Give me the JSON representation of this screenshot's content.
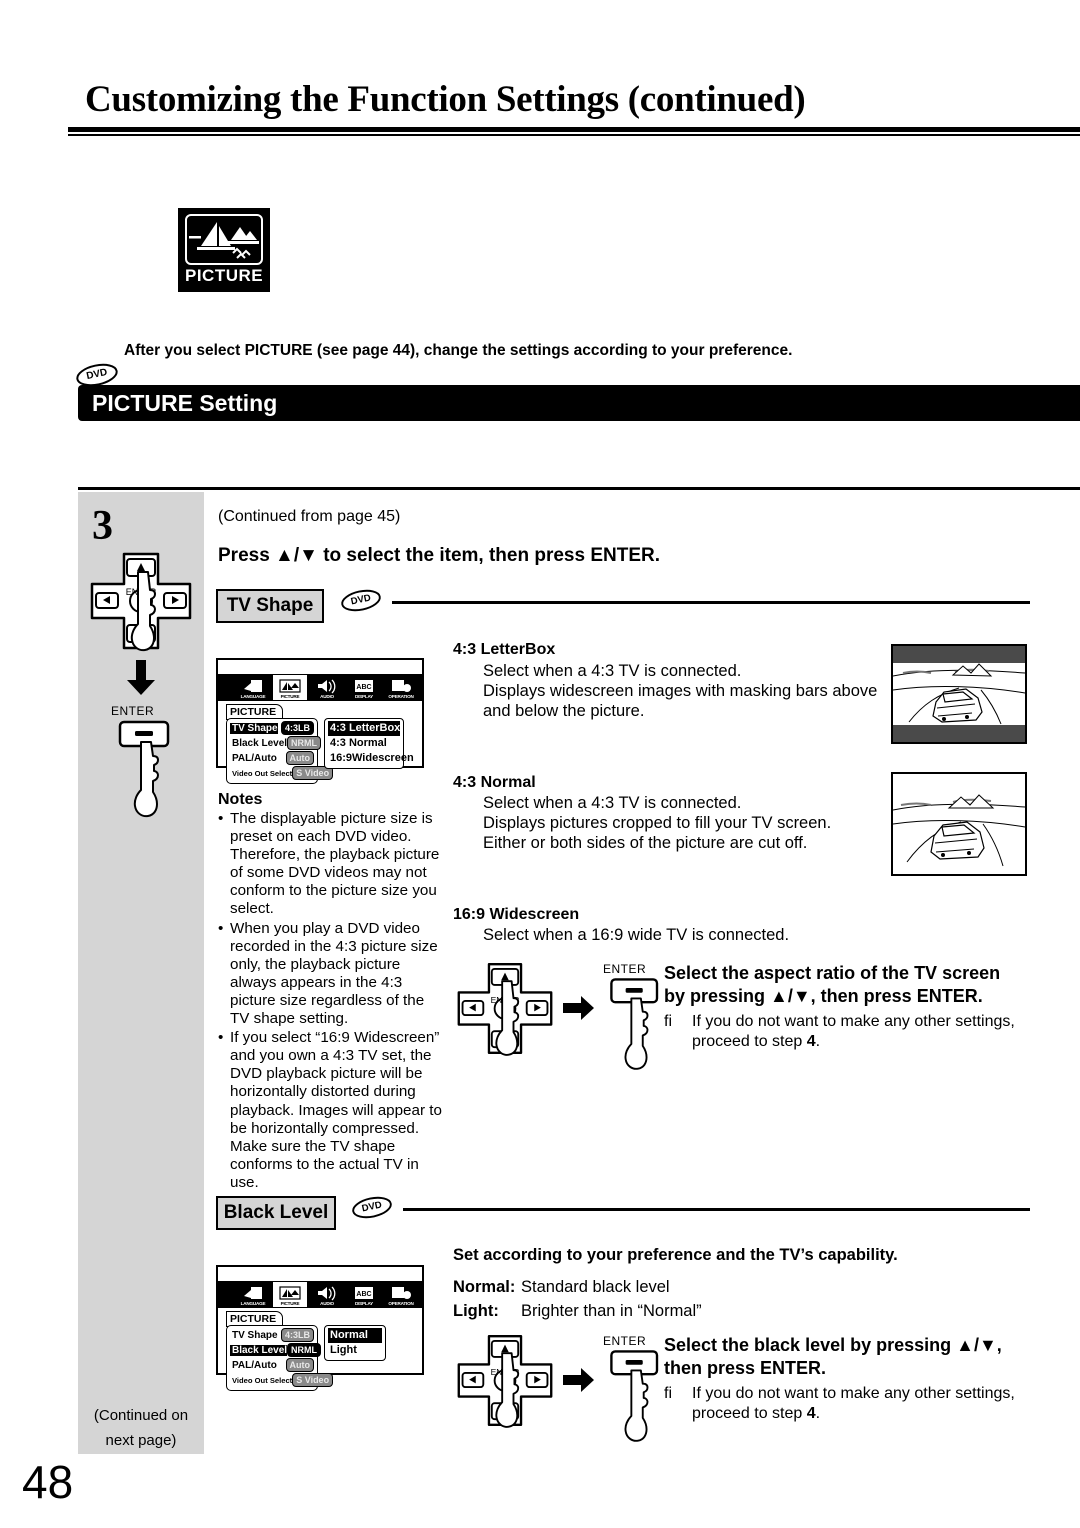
{
  "header": {
    "title": "Customizing the Function Settings (continued)"
  },
  "badge": {
    "label": "PICTURE",
    "icon": "picture-scene-icon"
  },
  "intro": {
    "text": "After you select PICTURE (see page 44), change the settings according to your preference."
  },
  "section": {
    "title": "PICTURE Setting",
    "media_badge": "DVD"
  },
  "step": {
    "number": "3",
    "continued_from": "(Continued from page 45)",
    "instruction": "Press ▲/▼ to select the item, then press ENTER.",
    "enter_label": "ENTER",
    "continued_on_next": "(Continued on\nnext page)",
    "continued_on_next_line1": "(Continued on",
    "continued_on_next_line2": "next page)"
  },
  "tv_shape": {
    "label": "TV Shape",
    "media_badge": "DVD",
    "osd": {
      "tabs": [
        "LANGUAGE",
        "PICTURE",
        "AUDIO",
        "DISPLAY",
        "OPERATION"
      ],
      "selected_tab": "PICTURE",
      "panel_title": "PICTURE",
      "rows": [
        {
          "name": "TV Shape",
          "value": "4:3LB",
          "highlighted": true,
          "value_active": true
        },
        {
          "name": "Black Level",
          "value": "NRML",
          "highlighted": false,
          "value_active": false
        },
        {
          "name": "PAL/Auto",
          "value": "Auto",
          "highlighted": false,
          "value_active": false
        },
        {
          "name": "Video Out Select",
          "value": "S Video",
          "highlighted": false,
          "value_active": false
        }
      ],
      "submenu": [
        {
          "label": "4:3 LetterBox",
          "highlighted": true
        },
        {
          "label": "4:3 Normal",
          "highlighted": false
        },
        {
          "label": "16:9Widescreen",
          "highlighted": false
        }
      ]
    },
    "options": [
      {
        "title": "4:3 LetterBox",
        "lines": [
          "Select when a 4:3 TV is connected.",
          "Displays widescreen images with masking bars above",
          "and below the picture."
        ],
        "illustration": "tv-letterbox-car-illustration"
      },
      {
        "title": "4:3 Normal",
        "lines": [
          "Select when a 4:3 TV is connected.",
          "Displays pictures cropped to fill your TV screen.",
          "Either or both sides of the picture are cut off."
        ],
        "illustration": "tv-normal-car-illustration"
      },
      {
        "title": "16:9 Widescreen",
        "lines": [
          "Select when a 16:9 wide TV is connected."
        ],
        "illustration": null
      }
    ],
    "action": {
      "enter_label": "ENTER",
      "title_line1": "Select the aspect ratio of the TV screen",
      "title_line2": "by pressing ▲/▼, then press ENTER.",
      "note_marker": "fi",
      "note_line1": "If you do not want to make any other settings,",
      "note_line2_prefix": "proceed to step ",
      "note_line2_step": "4",
      "note_line2_suffix": "."
    }
  },
  "notes": {
    "heading": "Notes",
    "items": [
      "The displayable picture size is preset on each DVD video. Therefore, the playback picture of some DVD videos may not conform to the picture size you select.",
      "When you play a DVD video recorded in the 4:3 picture size only, the playback picture always appears in the 4:3 picture size regardless of the TV shape setting.",
      "If you select “16:9 Widescreen” and you own a 4:3 TV set, the DVD playback picture will be horizontally distorted during playback. Images will appear to be horizontally compressed. Make sure the TV shape conforms to the actual TV in use."
    ]
  },
  "black_level": {
    "label": "Black Level",
    "media_badge": "DVD",
    "osd": {
      "tabs": [
        "LANGUAGE",
        "PICTURE",
        "AUDIO",
        "DISPLAY",
        "OPERATION"
      ],
      "selected_tab": "PICTURE",
      "panel_title": "PICTURE",
      "rows": [
        {
          "name": "TV Shape",
          "value": "4:3LB",
          "highlighted": false,
          "value_active": false
        },
        {
          "name": "Black Level",
          "value": "NRML",
          "highlighted": true,
          "value_active": true
        },
        {
          "name": "PAL/Auto",
          "value": "Auto",
          "highlighted": false,
          "value_active": false
        },
        {
          "name": "Video Out Select",
          "value": "S Video",
          "highlighted": false,
          "value_active": false
        }
      ],
      "submenu": [
        {
          "label": "Normal",
          "highlighted": true
        },
        {
          "label": "Light",
          "highlighted": false
        }
      ]
    },
    "description": "Set according to your preference and the TV’s capability.",
    "definitions": [
      {
        "key": "Normal:",
        "value": "Standard black level"
      },
      {
        "key": "Light:",
        "value": "Brighter than in “Normal”"
      }
    ],
    "action": {
      "enter_label": "ENTER",
      "title_line1": "Select the black level by pressing ▲/▼,",
      "title_line2": "then press ENTER.",
      "note_marker": "fi",
      "note_line1": "If you do not want to make any other settings,",
      "note_line2_prefix": "proceed to step ",
      "note_line2_step": "4",
      "note_line2_suffix": "."
    }
  },
  "footer": {
    "page_number": "48"
  },
  "colors": {
    "ink": "#000000",
    "panel_grey": "#d5d5d5",
    "osd_grey": "#8a8a8a"
  }
}
